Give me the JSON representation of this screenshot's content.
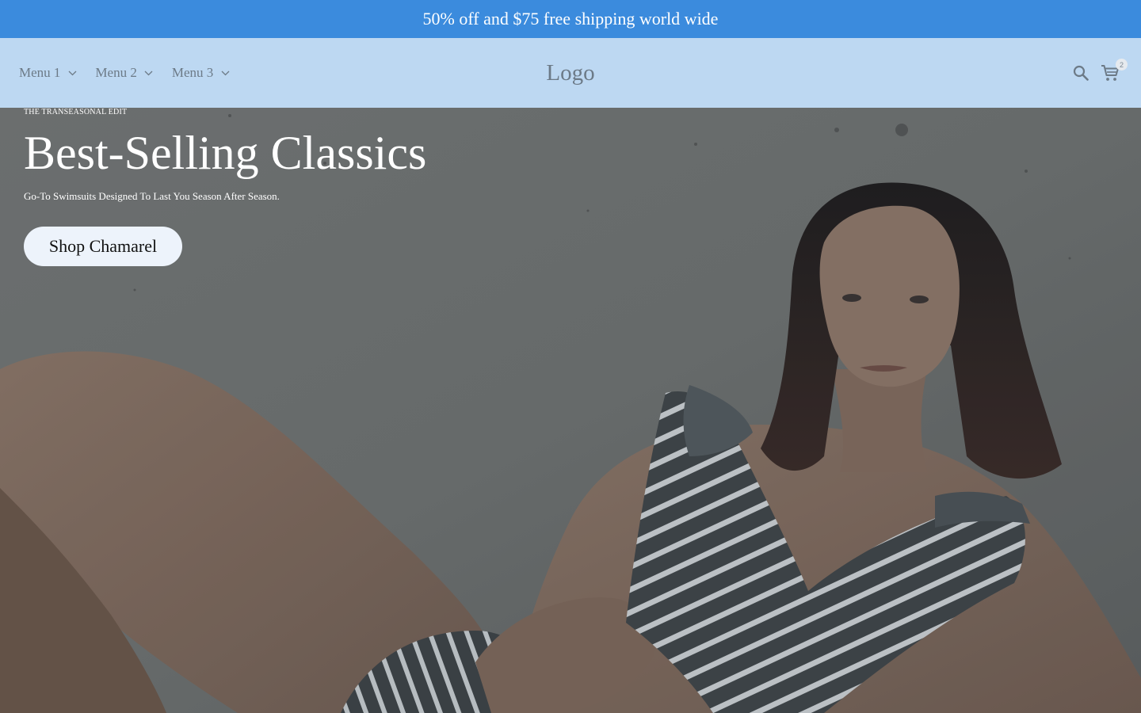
{
  "announcement": {
    "text": "50% off and $75 free shipping world wide"
  },
  "header": {
    "menu": [
      {
        "label": "Menu 1",
        "icon": "chevron-down-icon"
      },
      {
        "label": "Menu 2",
        "icon": "chevron-down-icon"
      },
      {
        "label": "Menu 3",
        "icon": "chevron-down-icon"
      }
    ],
    "logo": "Logo",
    "search_icon": "search-icon",
    "cart_icon": "cart-icon",
    "cart_count": "2"
  },
  "hero": {
    "eyebrow": "THE TRANSEASONAL EDIT",
    "title": "Best-Selling Classics",
    "subtitle": "Go-To Swimsuits Designed To Last You Season After Season.",
    "cta_label": "Shop Chamarel"
  },
  "colors": {
    "announcement_bg": "#3b8bdd",
    "header_bg": "#bdd8f2",
    "header_text": "#6c7a87",
    "cta_bg": "#edf3fb"
  }
}
